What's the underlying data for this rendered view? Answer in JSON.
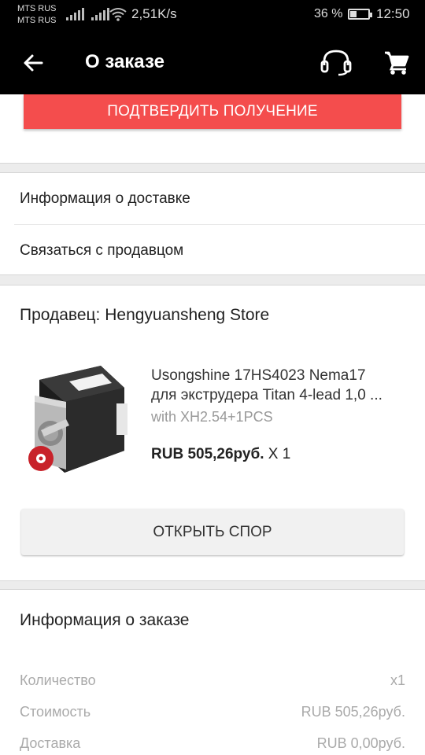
{
  "status_bar": {
    "carrier_1": "MTS RUS",
    "carrier_2": "MTS RUS",
    "net_speed": "2,51K/s",
    "battery_percent": "36 %",
    "battery_level": 0.36,
    "time": "12:50"
  },
  "app_bar": {
    "title": "О заказе",
    "icons": [
      "back-arrow-icon",
      "headset-icon",
      "cart-icon"
    ]
  },
  "actions": {
    "confirm_receipt": "ПОДТВЕРДИТЬ ПОЛУЧЕНИЕ"
  },
  "links": [
    {
      "label": "Информация о доставке"
    },
    {
      "label": "Связаться с продавцом"
    }
  ],
  "seller": {
    "title": "Продавец: Hengyuansheng Store",
    "product": {
      "name_line1": "Usongshine 17HS4023 Nema17",
      "name_line2": "для экструдера Titan 4-lead 1,0 ...",
      "variant": "with XH2.54+1PCS",
      "price": "RUB 505,26руб.",
      "quantity": "X 1"
    },
    "dispute_button": "ОТКРЫТЬ СПОР"
  },
  "order_info": {
    "title": "Информация о заказе",
    "rows": [
      {
        "label": "Количество",
        "value": "x1"
      },
      {
        "label": "Стоимость",
        "value": "RUB 505,26руб."
      },
      {
        "label": "Доставка",
        "value": "RUB 0,00руб."
      }
    ]
  },
  "colors": {
    "accent": "#f44d4d",
    "app_bar": "#000000",
    "background": "#ececec"
  }
}
